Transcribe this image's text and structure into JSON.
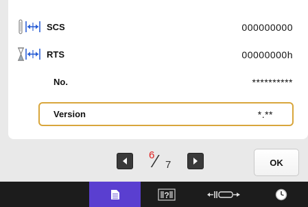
{
  "rows": {
    "scs": {
      "label": "SCS",
      "value": "000000000",
      "icon": "needle-stitch-width-icon"
    },
    "rts": {
      "label": "RTS",
      "value": "00000000h",
      "icon": "hourglass-stitch-width-icon"
    },
    "no": {
      "label": "No.",
      "value": "**********"
    },
    "version": {
      "label": "Version",
      "value": "*.**"
    }
  },
  "pager": {
    "current": "6",
    "total": "7",
    "current_color": "#e02020"
  },
  "buttons": {
    "ok_label": "OK"
  },
  "bottom_tabs": [
    {
      "name": "settings-page-tab",
      "icon": "page-icon",
      "active": true
    },
    {
      "name": "help-tab",
      "icon": "help-icon",
      "active": false
    },
    {
      "name": "embroidery-area-tab",
      "icon": "embroidery-frame-icon",
      "active": false
    },
    {
      "name": "clock-tab",
      "icon": "clock-icon",
      "active": false
    }
  ],
  "colors": {
    "accent_active": "#5a3fd0",
    "highlight_border": "#d8a53a",
    "stitch_icon_blue": "#2a5fd6"
  }
}
